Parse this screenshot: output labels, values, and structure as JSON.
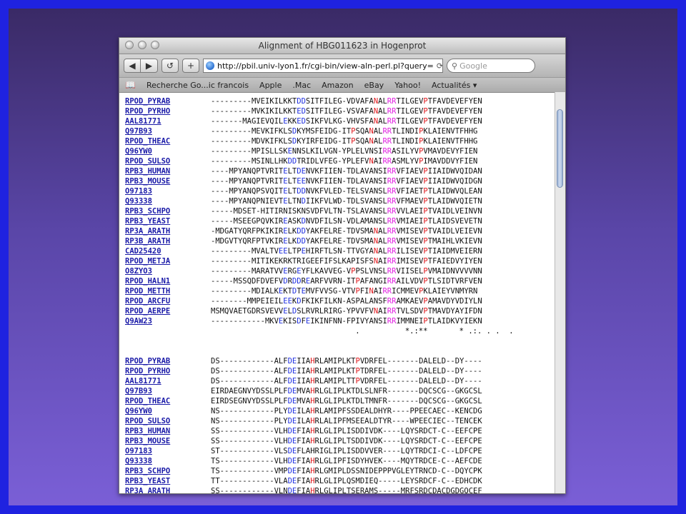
{
  "window": {
    "title": "Alignment of HBG011623 in Hogenprot",
    "url": "http://pbil.univ-lyon1.fr/cgi-bin/view-aln-perl.pl?query=",
    "search_placeholder": "Google"
  },
  "toolbar": {
    "back": "◀",
    "forward": "▶",
    "reload": "↺",
    "add": "+"
  },
  "bookmarks": [
    "Recherche Go...ic francois",
    "Apple",
    ".Mac",
    "Amazon",
    "eBay",
    "Yahoo!",
    "Actualités ▾"
  ],
  "block1": [
    {
      "name": "RPOD_PYRAB",
      "seq": "---------MVEIKILKKTDDSITFILEG-VDVAFANALRRTILGEVPTFAVDEVEFYEN"
    },
    {
      "name": "RPOD_PYRHO",
      "seq": "---------MVKIKILKKTEDSITFILEG-VSVAFANALRRTILGEVPTFAVDEVEFYEN"
    },
    {
      "name": "AAL81771",
      "seq": "-------MAGIEVQILEKKEDSIKFVLKG-VHVSFANALRRTILGEVPTFAVDEVEFYEN"
    },
    {
      "name": "Q97B93",
      "seq": "---------MEVKIFKLSDKYMSFEIDG-ITPSQANALRRTLINDIPKLAIENVTFHHG"
    },
    {
      "name": "RPOD_THEAC",
      "seq": "---------MDVKIFKLSDKYIRFEIDG-ITPSQANALRRTLINDIPKLAIENVTFHHG"
    },
    {
      "name": "Q96YW0",
      "seq": "---------MPISLLSKENNSLKILVGN-YPLELVNSIRRASILYVPVMAVDEVYFIEN"
    },
    {
      "name": "RPOD_SULSO",
      "seq": "---------MSINLLHKDDTRIDLVFEG-YPLEFVNAIRRASMLYVPIMAVDDVYFIEN"
    },
    {
      "name": "RPB3_HUMAN",
      "seq": "----MPYANQPTVRITELTDENVKFIIEN-TDLAVANSIRRVFIAEVPIIAIDWVQIDAN"
    },
    {
      "name": "RPB3_MOUSE",
      "seq": "----MPYANQPTVRITELTEENVKFIIEN-TDLAVANSIRRVFIAEVPIIAIDWVQIDGN"
    },
    {
      "name": "O97183",
      "seq": "----MPYANQPSVQITELTDDNVKFVLED-TELSVANSLRRVFIAETPTLAIDWVQLEAN"
    },
    {
      "name": "Q93338",
      "seq": "----MPYANQPNIEVTELTNDIIKFVLWD-TDLSVANSLRRVFMAEVPTLAIDWVQIETN"
    },
    {
      "name": "RPB3_SCHPO",
      "seq": "-----MDSET-HITIRNISKNSVDFVLTN-TSLAVANSLRRVVLAEIPTVAIDLVEINVN"
    },
    {
      "name": "RPB3_YEAST",
      "seq": "-----MSEEGPQVKIREASKDNVDFILSN-VDLAMANSLRRVMIAEIPTLAIDSVEVETN"
    },
    {
      "name": "RP3A_ARATH",
      "seq": "-MDGATYQRFPKIKIRELKDDYAKFELRE-TDVSMANALRRVMISEVPTVAIDLVEIEVN"
    },
    {
      "name": "RP3B_ARATH",
      "seq": "-MDGVTYQRFPTVKIRELKDDYAKFELRE-TDVSMANALRRVMISEVPTMAIHLVKIEVN"
    },
    {
      "name": "CAD25420",
      "seq": "---------MVALTVEELTPEHIRFTLSN-TTVGYANALRRILISEVPTIAIDMVEIERN"
    },
    {
      "name": "RPOD_METJA",
      "seq": "---------MITIKEKRKTRIGEEFIFSLKAPISFSNAIRRIMISEVPTFAIEDVYIYEN"
    },
    {
      "name": "O8ZYO3",
      "seq": "---------MARATVVERGEYFLKAVVEG-VPPSLVNSLRRVIISELPVMAIDNVVVVNN"
    },
    {
      "name": "RPOD_HALN1",
      "seq": "-----MSSQDFDVEFVDRDDREARFVVRN-ITPAFANGIRRAILVDVPTLSIDTVRFVEN"
    },
    {
      "name": "RPOD_METTH",
      "seq": "---------MDIALKEKTDTEMVFVVSG-VTVPFINAIRRICMMEVPKLAIEYVNMYRN"
    },
    {
      "name": "RPOD_ARCFU",
      "seq": "--------MMPEIEILEEKDFKIKFILKN-ASPALANSFRRAMKAEVPAMAVDYVDIYLN"
    },
    {
      "name": "RPOD_AERPE",
      "seq": "MSMQVAETGDRSVEVVELDSLRVRLRIRG-YPVVFVNAIRRTVLSDVPTMAVDYAYIFDN"
    },
    {
      "name": "Q9AW23",
      "seq": "------------MKVEKISDFEIKINFNN-FPIVYANSIRRIMMNEIPTLAIDKVYIEKN"
    }
  ],
  "consensus1": "                                .          *.:**       * .:. . .  .",
  "block2": [
    {
      "name": "RPOD_PYRAB",
      "seq": "DS------------ALFDEIIAHRLAMIPLKTPVDRFEL-------DALELD--DY----"
    },
    {
      "name": "RPOD_PYRHO",
      "seq": "DS------------ALFDEIIAHRLAMIPLKTPTDRFEL-------DALELD--DY----"
    },
    {
      "name": "AAL81771",
      "seq": "DS------------ALFDEIIAHRLAMIPLTTPVDRFEL-------DALELD--DY----"
    },
    {
      "name": "Q97B93",
      "seq": "EIRDAEGNVYDSSLPLFDEMVAHRLGLIPLKTDLSLNFR-------DQCSCG--GKGCSL"
    },
    {
      "name": "RPOD_THEAC",
      "seq": "EIRDSEGNVYDSSLPLFDEMVAHRLGLIPLKTDLTMNFR-------DQCSCG--GKGCSL"
    },
    {
      "name": "Q96YW0",
      "seq": "NS------------PLYDEILAHRLAMIPFSSDEALDHYR----PPEECAEC--KENCDG"
    },
    {
      "name": "RPOD_SULSO",
      "seq": "NS------------PLYDEILAHRLALIPFMSEEALDTYR----WPEECIEC--TENCEK"
    },
    {
      "name": "RPB3_HUMAN",
      "seq": "SS------------VLHDEFIAHRLGLIPLISDDIVDK----LQYSRDCT-C--EEFCPE"
    },
    {
      "name": "RPB3_MOUSE",
      "seq": "SS------------VLHDEFIAHRLGLIPLTSDDIVDK----LQYSRDCT-C--EEFCPE"
    },
    {
      "name": "O97183",
      "seq": "ST------------VLSDEFLAHRIGLIPLISDDVVER----LQYTRDCI-C--LDFCPE"
    },
    {
      "name": "Q93338",
      "seq": "TS------------VLHDEFIAHRLGLIPFISDYHVEK----MQYTRDCE-C--AEFCDE"
    },
    {
      "name": "RPB3_SCHPO",
      "seq": "TS------------VMPDEFIAHRLGMIPLDSSNIDEPPPVGLEYTRNCD-C--DQYCPK"
    },
    {
      "name": "RPB3_YEAST",
      "seq": "TT------------VLADEFIAHRLGLIPLQSMDIEQ-----LEYSRDCF-C--EDHCDK"
    },
    {
      "name": "RP3A_ARATH",
      "seq": "SS------------VLNDEFIAHRLGLIPLTSERAMS-----MRFSRDCDACDGDGQCEF"
    }
  ],
  "colors": {
    "red": "#e0171b",
    "magenta": "#e020e0",
    "blue": "#2030e0",
    "green": "#1a9a1a",
    "link": "#1a1aa8"
  }
}
